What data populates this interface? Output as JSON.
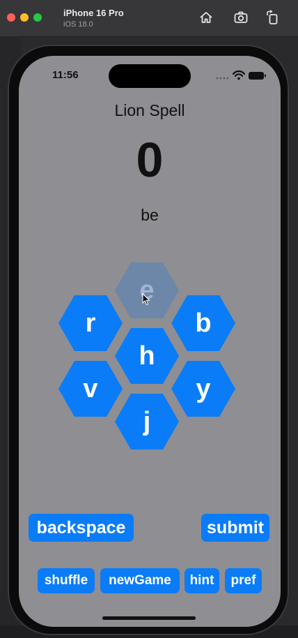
{
  "window": {
    "title": "iPhone 16 Pro",
    "subtitle": "iOS 18.0"
  },
  "toolbar": {
    "icons": [
      "home-icon",
      "screenshot-icon",
      "rotate-icon"
    ]
  },
  "status_bar": {
    "time": "11:56",
    "icons": [
      "signal-icon",
      "wifi-icon",
      "battery-icon"
    ]
  },
  "app": {
    "title": "Lion Spell",
    "score": "0",
    "current_word": "be",
    "letters": {
      "top": "e",
      "upper_left": "r",
      "upper_right": "b",
      "center": "h",
      "lower_left": "v",
      "lower_right": "y",
      "bottom": "j"
    },
    "buttons": {
      "backspace": "backspace",
      "submit": "submit",
      "shuffle": "shuffle",
      "new_game": "newGame",
      "hint": "hint",
      "pref": "pref"
    }
  },
  "colors": {
    "accent": "#0a7cf7",
    "screen_background": "#8e8e93",
    "faded_hex": "#6d87a8"
  }
}
